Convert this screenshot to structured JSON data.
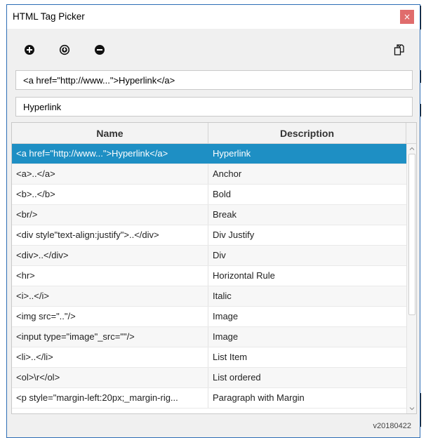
{
  "window": {
    "title": "HTML Tag Picker",
    "close_label": "×",
    "version": "v20180422"
  },
  "toolbar": {
    "add_icon": "add-circle-icon",
    "download_icon": "download-circle-icon",
    "remove_icon": "remove-circle-icon",
    "copy_icon": "copy-icon"
  },
  "fields": {
    "tag_value": "<a href=\"http://www...\">Hyperlink</a>",
    "description_value": "Hyperlink"
  },
  "table": {
    "columns": [
      "Name",
      "Description"
    ],
    "rows": [
      {
        "name": "<a href=\"http://www...\">Hyperlink</a>",
        "desc": "Hyperlink",
        "selected": true
      },
      {
        "name": "<a>..</a>",
        "desc": "Anchor"
      },
      {
        "name": "<b>..</b>",
        "desc": "Bold"
      },
      {
        "name": "<br/>",
        "desc": "Break"
      },
      {
        "name": "<div style\"text-align:justify\">..</div>",
        "desc": "Div Justify"
      },
      {
        "name": "<div>..</div>",
        "desc": "Div"
      },
      {
        "name": "<hr>",
        "desc": "Horizontal Rule"
      },
      {
        "name": "<i>..</i>",
        "desc": "Italic"
      },
      {
        "name": "<img src=\"..\"/>",
        "desc": "Image"
      },
      {
        "name": "<input type=\"image\"_src=\"\"/>",
        "desc": "Image"
      },
      {
        "name": "<li>..</li>",
        "desc": "List Item"
      },
      {
        "name": "<ol>\\r</ol>",
        "desc": "List ordered"
      },
      {
        "name": "<p style=\"margin-left:20px;_margin-rig...",
        "desc": "Paragraph with Margin"
      }
    ]
  },
  "colors": {
    "selection": "#1e8fc4",
    "close_button": "#e06c6c",
    "window_border": "#2d6db5"
  }
}
